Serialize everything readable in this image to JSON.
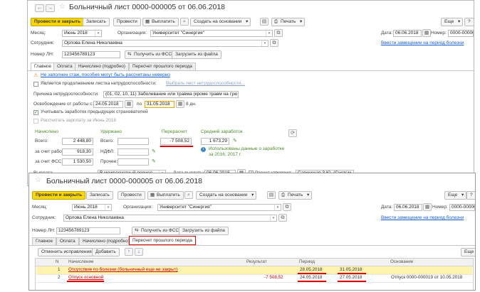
{
  "doc1": {
    "title": "Больничный лист 0000-000005 от 06.06.2018",
    "nav_back": "←",
    "nav_fwd": "→",
    "star": "☆",
    "toolbar": {
      "post_close": "Провести и закрыть",
      "save": "Записать",
      "post": "Провести",
      "pay": "Выплатить",
      "create_based": "Создать на основании",
      "print": "Печать",
      "more": "Еще",
      "help": "?"
    },
    "header": {
      "month_label": "Месяц:",
      "month_value": "Июнь 2018",
      "org_label": "Организация:",
      "org_value": "Университет \"Синергия\"",
      "date_label": "Дата:",
      "date_value": "06.06.2018",
      "number_label": "Номер:",
      "number_value": "0000-000005",
      "employee_label": "Сотрудник:",
      "employee_value": "Орлова Елена Николаевна",
      "replacement_link": "Ввести замещение на период болезни",
      "ln_label": "Номер ЛН:",
      "ln_value": "123456789123",
      "get_fss": "Получить из ФСС",
      "load_file": "Загрузить из файла"
    },
    "tabs": [
      "Главное",
      "Оплата",
      "Начислено (подробно)",
      "Пересчет прошлого периода"
    ],
    "main": {
      "warning_link": "Не заполнен стаж, пособия могут быть рассчитаны неверно",
      "continuation_label": "Является продолжением листка нетрудоспособности:",
      "continuation_link": "Выбрать лист нетрудоспособности...",
      "cause_label": "Причина нетрудоспособности:",
      "cause_value": "(01, 02, 10, 11) Заболевание или травма (кроме травм на про",
      "release_label": "Освобождение от работы с:",
      "release_from": "24.05.2018",
      "release_to_label": "по",
      "release_to": "31.05.2018",
      "days": "8 дн.",
      "prev_insurers": "Учитывать заработок предыдущих страхователей",
      "calc_salary": "Рассчитать зарплату за Июнь 2018",
      "accrued_head": "Начислено",
      "withheld_head": "Удержано",
      "recalc_head": "Перерасчет",
      "avg_head": "Средний заработок",
      "total_label": "Всего:",
      "total_value": "2 448,80",
      "withheld_total_label": "Всего:",
      "recalc_value": "-7 508,52",
      "avg_value": "1 673,29",
      "employer_label": "за счет работ.:",
      "employer_value": "918,30",
      "ndfl_label": "НДФЛ:",
      "fss_label": "за счет ФСС:",
      "fss_value": "1 530,50",
      "other_label": "Прочее:",
      "info_text": "Использованы данные о заработке за 2016, 2017 г.",
      "refresh": "⟳",
      "payment_label": "Выплата:",
      "payment_value": "В межрасчетный период",
      "pay_date_label": "Дата выплаты:",
      "pay_date_value": "06.06.2018",
      "approved_label": "Расчет утвердил:",
      "approved_value": "Савинская З.Ю. (Систем"
    }
  },
  "doc2": {
    "title": "Больничный лист 0000-000005 от 06.06.2018",
    "toolbar": {
      "post_close": "Провести и закрыть",
      "save": "Записать",
      "post": "Провести",
      "pay": "Выплатить",
      "create_based": "Создать на основании",
      "print": "Печать",
      "more": "Еще",
      "help": "?"
    },
    "header": {
      "month_label": "Месяц:",
      "month_value": "Июнь 2018",
      "org_label": "Организация:",
      "org_value": "Университет \"Синергия\"",
      "date_label": "Дата:",
      "date_value": "06.06.2018",
      "number_label": "Номер:",
      "number_value": "0000-000005",
      "employee_label": "Сотрудник:",
      "employee_value": "Орлова Елена Николаевна",
      "replacement_link": "Ввести замещение на период болезни",
      "ln_label": "Номер ЛН:",
      "ln_value": "123456789123",
      "get_fss": "Получить из ФСС",
      "load_file": "Загрузить из файла"
    },
    "tabs": [
      "Главное",
      "Оплата",
      "Начислено (подробно)",
      "Пересчет прошлого периода"
    ],
    "table_toolbar": {
      "cancel_fix": "Отменить исправления",
      "add": "Добавить",
      "up": "↑",
      "down": "↓",
      "more": "Еще"
    },
    "columns": {
      "n": "N",
      "accrual": "Начисление",
      "result": "Результат",
      "period": "Период",
      "basis": "Основание"
    },
    "rows": [
      {
        "n": "1",
        "accrual": "Отсутствие по болезни (больничный еще не закрыт)",
        "result": "",
        "from": "28.05.2018",
        "to": "31.05.2018",
        "basis": ""
      },
      {
        "n": "2",
        "accrual": "Отпуск основной",
        "result": "-7 508,52",
        "from": "24.05.2018",
        "to": "27.05.2018",
        "basis": "Отпуск 0000-000019 от 10.05.2018"
      }
    ]
  }
}
